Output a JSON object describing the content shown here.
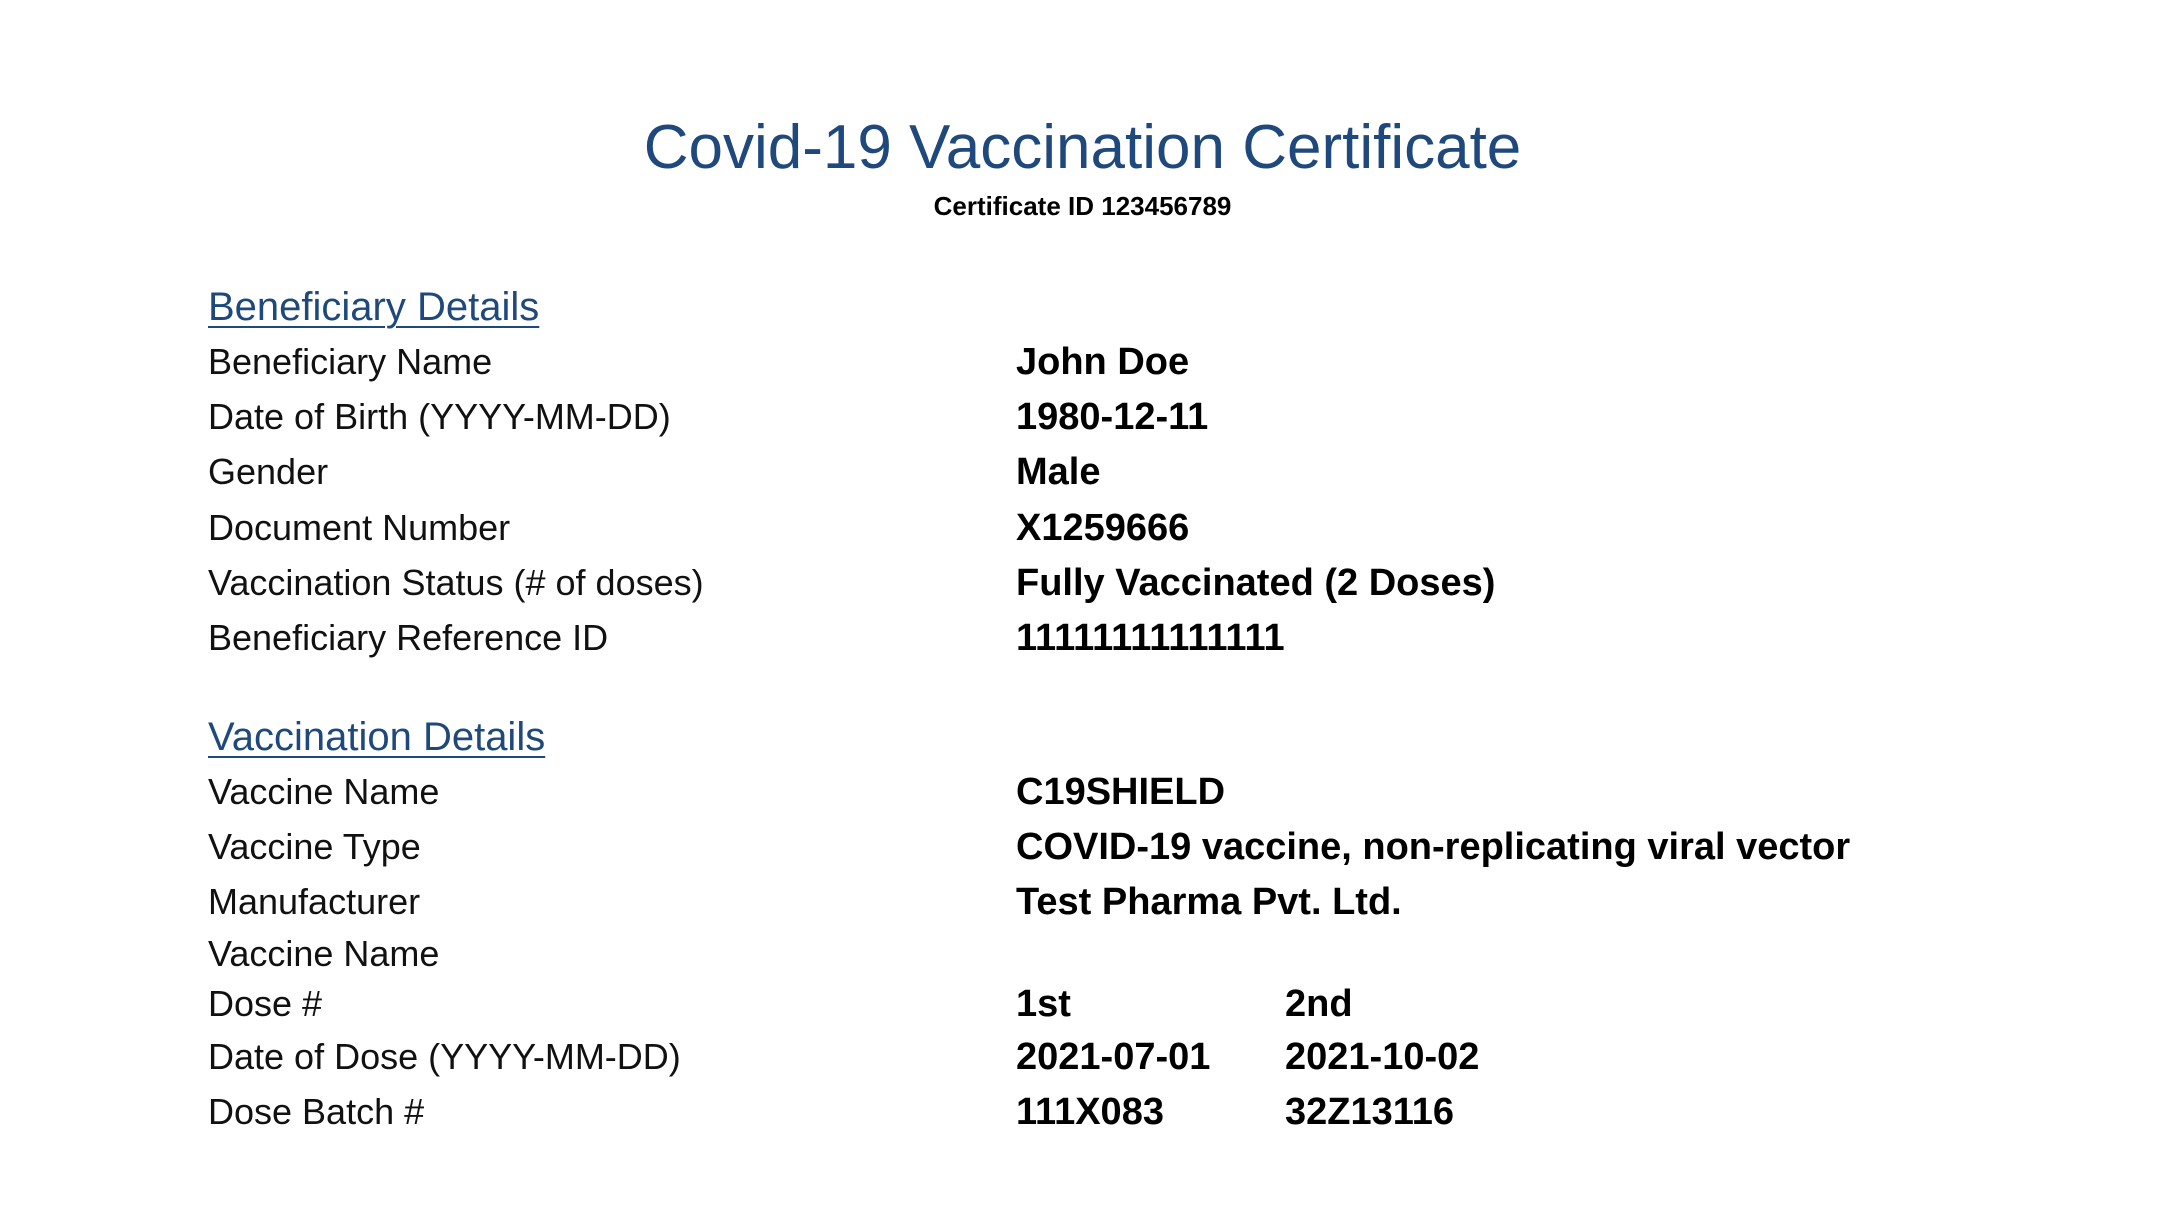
{
  "header": {
    "title": "Covid-19 Vaccination Certificate",
    "certificate_id": "Certificate ID 123456789"
  },
  "beneficiary": {
    "heading": "Beneficiary Details",
    "rows": [
      {
        "label": "Beneficiary Name",
        "value": "John Doe"
      },
      {
        "label": "Date of Birth (YYYY-MM-DD)",
        "value": "1980-12-11"
      },
      {
        "label": "Gender",
        "value": "Male"
      },
      {
        "label": "Document Number",
        "value": "X1259666"
      },
      {
        "label": "Vaccination Status (# of doses)",
        "value": "Fully Vaccinated (2 Doses)"
      },
      {
        "label": "Beneficiary Reference ID",
        "value": "11111111111111"
      }
    ]
  },
  "vaccination": {
    "heading": "Vaccination Details",
    "rows": [
      {
        "label": "Vaccine Name",
        "value": "C19SHIELD"
      },
      {
        "label": "Vaccine Type",
        "value": "COVID-19 vaccine, non-replicating viral vector"
      },
      {
        "label": "Manufacturer",
        "value": "Test Pharma Pvt. Ltd."
      },
      {
        "label": "Vaccine Name",
        "value": ""
      }
    ],
    "dose_rows": [
      {
        "label": "Dose #",
        "dose1": "1st",
        "dose2": "2nd"
      },
      {
        "label": "Date of Dose (YYYY-MM-DD)",
        "dose1": "2021-07-01",
        "dose2": "2021-10-02"
      },
      {
        "label": "Dose Batch #",
        "dose1": "111X083",
        "dose2": "32Z13116"
      }
    ]
  },
  "colors": {
    "heading": "#1f497d",
    "text": "#000000",
    "background": "#ffffff"
  }
}
